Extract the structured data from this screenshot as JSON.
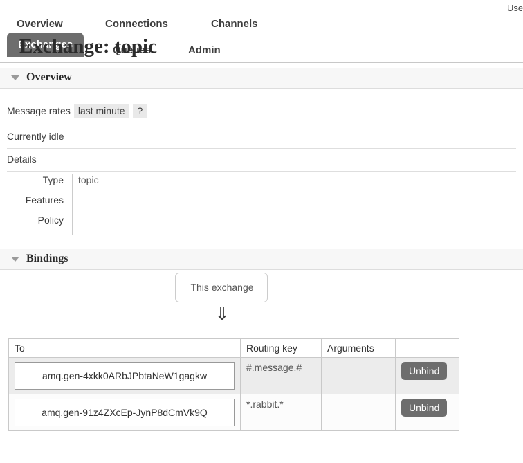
{
  "header": {
    "user_label": "Use",
    "page_title": "Exchange: topic"
  },
  "nav": {
    "primary": [
      {
        "label": "Overview",
        "active": false
      },
      {
        "label": "Connections",
        "active": false
      },
      {
        "label": "Channels",
        "active": false
      }
    ],
    "secondary": [
      {
        "label": "Exchanges",
        "active": true
      },
      {
        "label": "Queues",
        "active": false
      },
      {
        "label": "Admin",
        "active": false
      }
    ]
  },
  "sections": {
    "overview": {
      "title": "Overview",
      "message_rates_label": "Message rates",
      "message_rates_period": "last minute",
      "help_label": "?",
      "status": "Currently idle",
      "details_label": "Details",
      "details": [
        {
          "key": "Type",
          "value": "topic"
        },
        {
          "key": "Features",
          "value": ""
        },
        {
          "key": "Policy",
          "value": ""
        }
      ]
    },
    "bindings": {
      "title": "Bindings",
      "exchange_box_label": "This exchange",
      "arrow_glyph": "⇓",
      "columns": [
        "To",
        "Routing key",
        "Arguments",
        ""
      ],
      "rows": [
        {
          "to": "amq.gen-4xkk0ARbJPbtaNeW1gagkw",
          "routing_key": "#.message.#",
          "arguments": "",
          "action": "Unbind"
        },
        {
          "to": "amq.gen-91z4ZXcEp-JynP8dCmVk9Q",
          "routing_key": "*.rabbit.*",
          "arguments": "",
          "action": "Unbind"
        }
      ]
    }
  },
  "colors": {
    "active_tab": "#6d6d6d",
    "chip_bg": "#e9e9e9",
    "section_band": "#f7f7f7",
    "row_shade": "#ececec",
    "button_bg": "#6d6d6d"
  }
}
